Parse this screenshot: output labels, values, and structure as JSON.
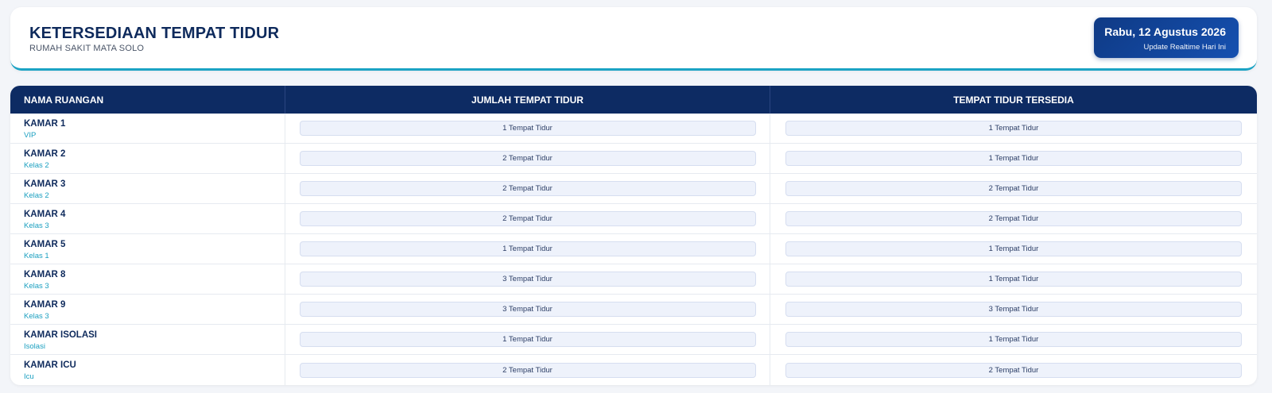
{
  "header": {
    "title": "KETERSEDIAAN TEMPAT TIDUR",
    "subtitle": "RUMAH SAKIT MATA SOLO",
    "date": "Rabu, 12 Agustus 2026",
    "update_note": "Update Realtime Hari Ini"
  },
  "table": {
    "columns": [
      "NAMA RUANGAN",
      "JUMLAH TEMPAT TIDUR",
      "TEMPAT TIDUR TERSEDIA"
    ],
    "rows": [
      {
        "name": "KAMAR 1",
        "class": "VIP",
        "total": "1 Tempat Tidur",
        "available": "1 Tempat Tidur"
      },
      {
        "name": "KAMAR 2",
        "class": "Kelas 2",
        "total": "2 Tempat Tidur",
        "available": "1 Tempat Tidur"
      },
      {
        "name": "KAMAR 3",
        "class": "Kelas 2",
        "total": "2 Tempat Tidur",
        "available": "2 Tempat Tidur"
      },
      {
        "name": "KAMAR 4",
        "class": "Kelas 3",
        "total": "2 Tempat Tidur",
        "available": "2 Tempat Tidur"
      },
      {
        "name": "KAMAR 5",
        "class": "Kelas 1",
        "total": "1 Tempat Tidur",
        "available": "1 Tempat Tidur"
      },
      {
        "name": "KAMAR 8",
        "class": "Kelas 3",
        "total": "3 Tempat Tidur",
        "available": "1 Tempat Tidur"
      },
      {
        "name": "KAMAR 9",
        "class": "Kelas 3",
        "total": "3 Tempat Tidur",
        "available": "3 Tempat Tidur"
      },
      {
        "name": "KAMAR ISOLASI",
        "class": "Isolasi",
        "total": "1 Tempat Tidur",
        "available": "1 Tempat Tidur"
      },
      {
        "name": "KAMAR ICU",
        "class": "Icu",
        "total": "2 Tempat Tidur",
        "available": "2 Tempat Tidur"
      }
    ]
  },
  "colors": {
    "primary": "#0d2b63",
    "accent": "#1ba3c4",
    "pill_bg": "#eef2fb"
  }
}
